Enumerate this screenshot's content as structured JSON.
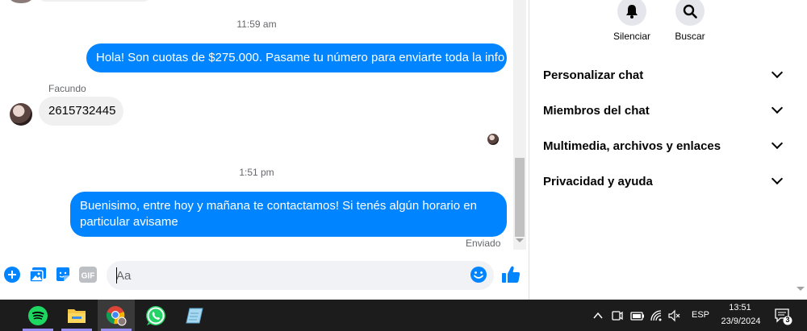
{
  "chat": {
    "messages": [
      {
        "type": "timestamp",
        "text": "11:59 am"
      },
      {
        "type": "outgoing",
        "text": "Hola! Son cuotas de $275.000. Pasame tu número para enviarte toda la info"
      },
      {
        "type": "incoming",
        "sender": "Facundo",
        "text": "2615732445"
      },
      {
        "type": "timestamp",
        "text": "1:51 pm"
      },
      {
        "type": "outgoing",
        "text": "Buenisimo, entre hoy y mañana te contactamos! Si tenés algún horario en particular avisame"
      }
    ],
    "status": "Enviado"
  },
  "composer": {
    "placeholder": "Aa",
    "tools": [
      "plus-icon",
      "photo-icon",
      "sticker-icon",
      "gif-icon"
    ],
    "gif_label": "GIF"
  },
  "panel": {
    "actions": [
      {
        "label": "Silenciar",
        "icon": "bell-icon"
      },
      {
        "label": "Buscar",
        "icon": "search-icon"
      }
    ],
    "sections": [
      {
        "title": "Personalizar chat"
      },
      {
        "title": "Miembros del chat"
      },
      {
        "title": "Multimedia, archivos y enlaces"
      },
      {
        "title": "Privacidad y ayuda"
      }
    ]
  },
  "taskbar": {
    "apps": [
      "spotify-icon",
      "file-explorer-icon",
      "chrome-icon",
      "whatsapp-icon",
      "notepad-icon"
    ],
    "tray": {
      "language": "ESP",
      "time": "13:51",
      "date": "23/9/2024",
      "notifications": "3"
    }
  },
  "colors": {
    "accent": "#0084ff",
    "bubble_in": "#f0f0f0",
    "taskbar": "#1c1c1c"
  }
}
